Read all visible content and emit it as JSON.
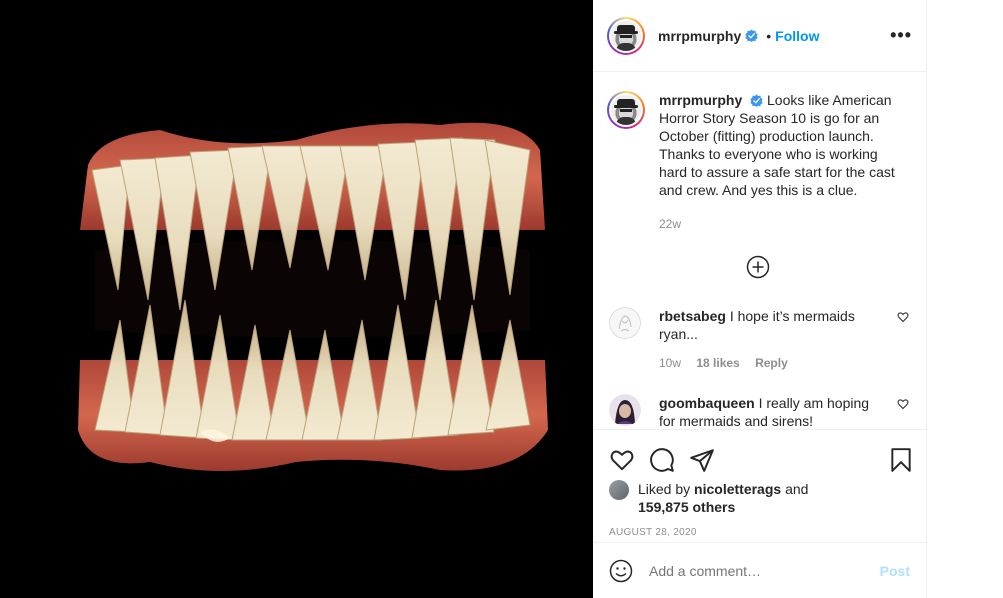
{
  "post": {
    "image_icon": "fake-teeth-image"
  },
  "header": {
    "username": "mrrpmurphy",
    "dot": "•",
    "follow_label": "Follow",
    "more_label": "•••"
  },
  "caption": {
    "username": "mrrpmurphy",
    "text": "Looks like American Horror Story Season 10 is go for an October (fitting) production launch. Thanks to everyone who is working hard to assure a safe start for the cast and crew. And yes this is a clue.",
    "time": "22w"
  },
  "comments": [
    {
      "username": "rbetsabeg",
      "text": "I hope it’s mermaids ryan...",
      "time": "10w",
      "likes": "18 likes",
      "reply": "Reply"
    },
    {
      "username": "goombaqueen",
      "text": "I really am hoping for mermaids and sirens!",
      "time": "",
      "likes": "",
      "reply": ""
    }
  ],
  "liked": {
    "prefix": "Liked by",
    "user": "nicoletterags",
    "and": "and",
    "others": "159,875 others"
  },
  "date": "AUGUST 28, 2020",
  "add_comment": {
    "placeholder": "Add a comment…",
    "post_label": "Post"
  },
  "colors": {
    "accent": "#0095f6",
    "post_disabled": "#b2dffc",
    "muted": "#8e8e8e"
  }
}
